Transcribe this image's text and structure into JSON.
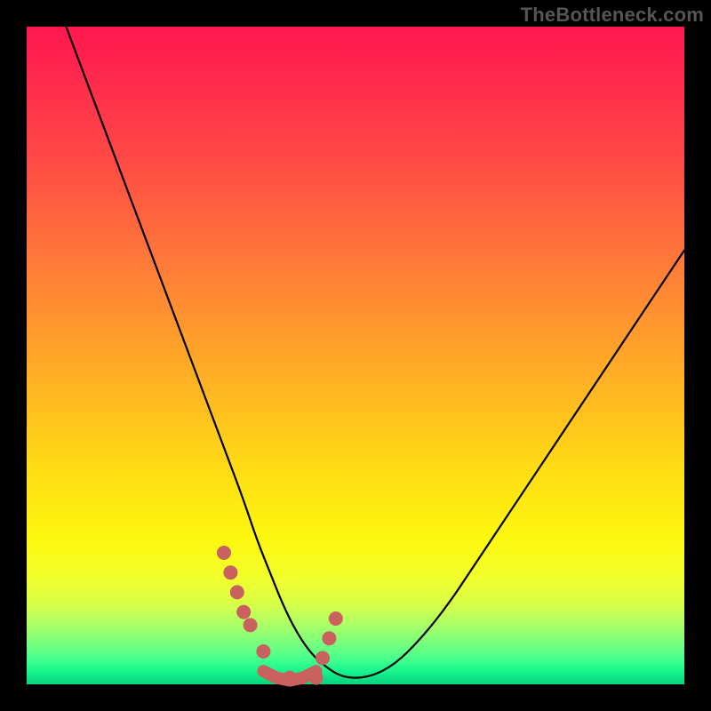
{
  "watermark": "TheBottleneck.com",
  "colors": {
    "curve": "#000000",
    "marker": "#c9615f",
    "frame": "#000000"
  },
  "chart_data": {
    "type": "line",
    "title": "",
    "xlabel": "",
    "ylabel": "",
    "xlim": [
      0,
      100
    ],
    "ylim": [
      0,
      100
    ],
    "series": [
      {
        "name": "bottleneck-curve",
        "x": [
          6,
          9,
          12,
          15,
          18,
          21,
          24,
          27,
          30,
          33,
          35,
          37,
          39,
          41,
          43,
          45,
          48,
          52,
          56,
          60,
          64,
          68,
          72,
          76,
          80,
          84,
          88,
          92,
          96,
          100
        ],
        "y": [
          100,
          92,
          84,
          76,
          68,
          60,
          52,
          44,
          36,
          28,
          22,
          17,
          12,
          8,
          5,
          3,
          1,
          1,
          3,
          7,
          12,
          18,
          24,
          30,
          36,
          42,
          48,
          54,
          60,
          66
        ]
      }
    ],
    "markers": {
      "name": "highlight-dots",
      "x": [
        30,
        31,
        32,
        33,
        34,
        36,
        40,
        44,
        45,
        46,
        47
      ],
      "y": [
        20,
        17,
        14,
        11,
        9,
        5,
        1,
        1,
        4,
        7,
        10
      ]
    },
    "trough_segment": {
      "x": [
        36,
        38,
        40,
        42,
        44
      ],
      "y": [
        2,
        1,
        0.6,
        1,
        2
      ]
    },
    "gradient_stops": [
      {
        "pct": 0,
        "color": "#ff1750"
      },
      {
        "pct": 20,
        "color": "#ff4a45"
      },
      {
        "pct": 44,
        "color": "#ff9330"
      },
      {
        "pct": 68,
        "color": "#ffde14"
      },
      {
        "pct": 84,
        "color": "#f1ff2e"
      },
      {
        "pct": 94,
        "color": "#74ff80"
      },
      {
        "pct": 100,
        "color": "#0bd27c"
      }
    ]
  }
}
